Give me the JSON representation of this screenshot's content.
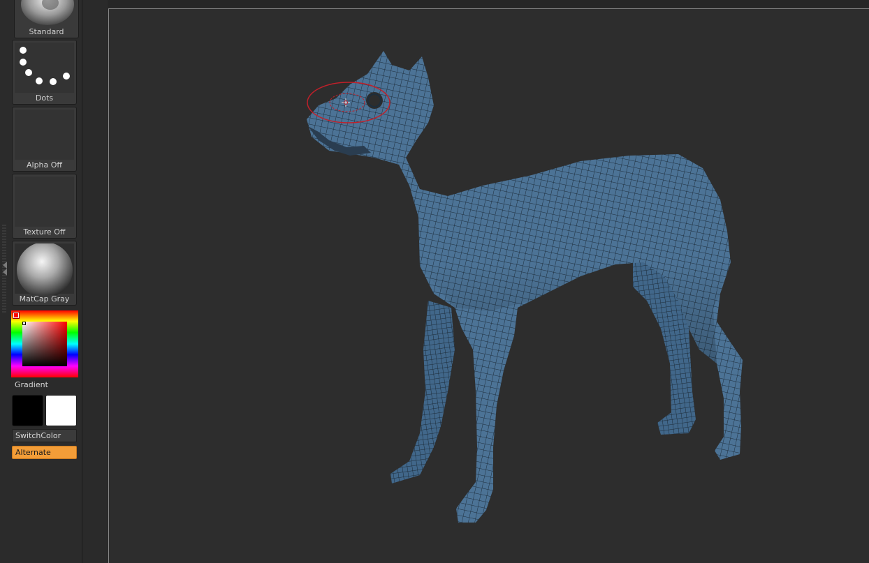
{
  "shelf": {
    "brush_label": "Standard",
    "stroke_label": "Dots",
    "alpha_label": "Alpha Off",
    "texture_label": "Texture Off",
    "material_label": "MatCap Gray",
    "gradient_label": "Gradient",
    "switch_color_label": "SwitchColor",
    "alternate_label": "Alternate",
    "main_color": "#000000",
    "secondary_color": "#ffffff",
    "accent_color": "#f39d38"
  },
  "canvas": {
    "model_color": "#4c7396",
    "wire_color": "#1d2d3b",
    "brush_cursor_color": "#c0202a"
  }
}
